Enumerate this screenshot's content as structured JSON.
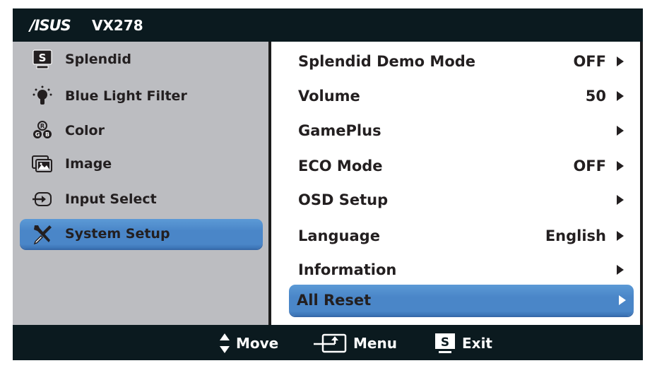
{
  "header": {
    "brand": "/ISUS",
    "model": "VX278"
  },
  "sidebar": {
    "items": [
      {
        "label": "Splendid",
        "icon": "splendid-s-icon",
        "selected": false
      },
      {
        "label": "Blue Light Filter",
        "icon": "light-bulb-icon",
        "selected": false
      },
      {
        "label": "Color",
        "icon": "rgb-color-icon",
        "selected": false
      },
      {
        "label": "Image",
        "icon": "image-icon",
        "selected": false
      },
      {
        "label": "Input Select",
        "icon": "input-select-icon",
        "selected": false
      },
      {
        "label": "System Setup",
        "icon": "wrench-screwdriver-icon",
        "selected": true
      }
    ]
  },
  "submenu": {
    "items": [
      {
        "label": "Splendid Demo Mode",
        "value": "OFF",
        "selected": false
      },
      {
        "label": "Volume",
        "value": "50",
        "selected": false
      },
      {
        "label": "GamePlus",
        "value": "",
        "selected": false
      },
      {
        "label": "ECO Mode",
        "value": "OFF",
        "selected": false
      },
      {
        "label": "OSD Setup",
        "value": "",
        "selected": false
      },
      {
        "label": "Language",
        "value": "English",
        "selected": false
      },
      {
        "label": "Information",
        "value": "",
        "selected": false
      },
      {
        "label": "All Reset",
        "value": "",
        "selected": true
      }
    ]
  },
  "footer": {
    "move_label": "Move",
    "menu_label": "Menu",
    "exit_label": "Exit",
    "exit_key": "S"
  },
  "colors": {
    "frame": "#0b1a1f",
    "left_panel": "#bcbdc1",
    "right_panel": "#ffffff",
    "highlight": "#4a86c8",
    "text": "#231f20"
  }
}
